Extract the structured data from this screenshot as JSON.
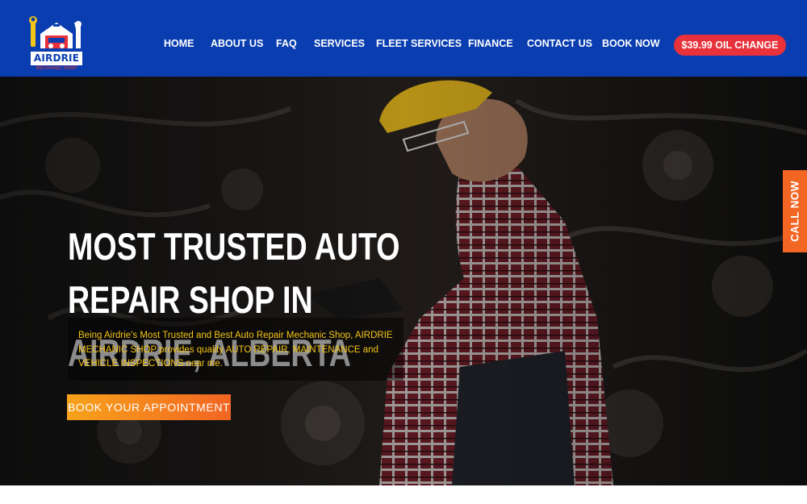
{
  "brand": {
    "name": "AIRDRIE",
    "subtitle": "MECHANIC SHOP",
    "logo_icon": "wrench-garage-logo-icon"
  },
  "nav": {
    "items": [
      {
        "label": "HOME"
      },
      {
        "label": "ABOUT US"
      },
      {
        "label": "FAQ"
      },
      {
        "label": "SERVICES"
      },
      {
        "label": "FLEET SERVICES"
      },
      {
        "label": "FINANCE"
      },
      {
        "label": "CONTACT US"
      },
      {
        "label": "BOOK NOW"
      }
    ],
    "cta_label": "$39.99 OIL CHANGE"
  },
  "hero": {
    "title_lines": [
      "MOST TRUSTED AUTO",
      "REPAIR SHOP IN",
      "AIRDRIE, ALBERTA"
    ],
    "description_lines": [
      "Being Airdrie's Most Trusted and Best Auto Repair Mechanic Shop, AIRDRIE",
      "MECHANIC SHOP provides quality AUTO REPAIR, MAINTENANCE and",
      "VEHICLE INSPECTIONS near me."
    ],
    "button_label": "BOOK YOUR APPOINTMENT"
  },
  "call_now": {
    "label": "CALL NOW"
  },
  "colors": {
    "header_blue": "#0a3eb0",
    "accent_red": "#e8313a",
    "accent_orange": "#f26522",
    "text_yellow": "#f5c518"
  }
}
